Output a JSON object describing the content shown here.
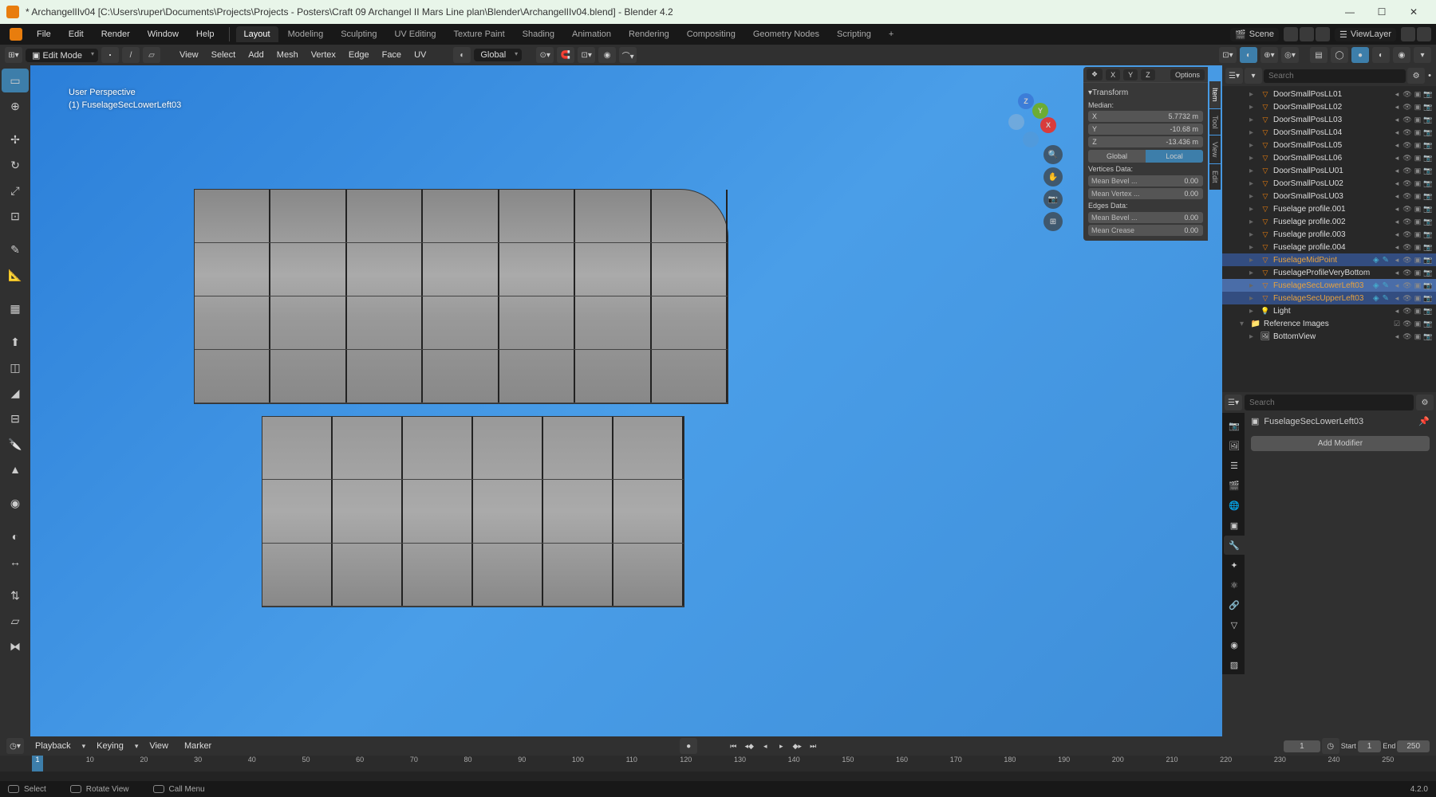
{
  "titlebar": {
    "title": "* ArchangelIIv04 [C:\\Users\\ruper\\Documents\\Projects\\Projects - Posters\\Craft 09 Archangel II Mars Line plan\\Blender\\ArchangelIIv04.blend] - Blender 4.2"
  },
  "menubar": {
    "items": [
      "File",
      "Edit",
      "Render",
      "Window",
      "Help"
    ],
    "tabs": [
      "Layout",
      "Modeling",
      "Sculpting",
      "UV Editing",
      "Texture Paint",
      "Shading",
      "Animation",
      "Rendering",
      "Compositing",
      "Geometry Nodes",
      "Scripting"
    ],
    "activeTab": "Layout",
    "scene": "Scene",
    "viewlayer": "ViewLayer"
  },
  "headerbar": {
    "mode": "Edit Mode",
    "menus": [
      "View",
      "Select",
      "Add",
      "Mesh",
      "Vertex",
      "Edge",
      "Face",
      "UV"
    ],
    "orientation": "Global"
  },
  "viewport": {
    "perspective": "User Perspective",
    "objname": "(1) FuselageSecLowerLeft03"
  },
  "npanel": {
    "xyzopts": [
      "X",
      "Y",
      "Z"
    ],
    "optionsLabel": "Options",
    "transform": "Transform",
    "median": "Median:",
    "x": {
      "axis": "X",
      "val": "5.7732 m"
    },
    "y": {
      "axis": "Y",
      "val": "-10.68 m"
    },
    "z": {
      "axis": "Z",
      "val": "-13.436 m"
    },
    "global": "Global",
    "local": "Local",
    "verticesData": "Vertices Data:",
    "meanBevel": "Mean Bevel ...",
    "meanVertex": "Mean Vertex ...",
    "edgesData": "Edges Data:",
    "meanCrease": "Mean Crease",
    "zeroA": "0.00",
    "zeroB": "0.00",
    "zeroC": "0.00",
    "zeroD": "0.00",
    "tabs": [
      "Item",
      "Tool",
      "View",
      "Edit"
    ]
  },
  "outliner": {
    "searchPlaceholder": "Search",
    "items": [
      {
        "name": "DoorSmallPosLL01",
        "indent": 1,
        "type": "mesh"
      },
      {
        "name": "DoorSmallPosLL02",
        "indent": 1,
        "type": "mesh"
      },
      {
        "name": "DoorSmallPosLL03",
        "indent": 1,
        "type": "mesh"
      },
      {
        "name": "DoorSmallPosLL04",
        "indent": 1,
        "type": "mesh"
      },
      {
        "name": "DoorSmallPosLL05",
        "indent": 1,
        "type": "mesh"
      },
      {
        "name": "DoorSmallPosLL06",
        "indent": 1,
        "type": "mesh"
      },
      {
        "name": "DoorSmallPosLU01",
        "indent": 1,
        "type": "mesh"
      },
      {
        "name": "DoorSmallPosLU02",
        "indent": 1,
        "type": "mesh"
      },
      {
        "name": "DoorSmallPosLU03",
        "indent": 1,
        "type": "mesh"
      },
      {
        "name": "Fuselage profile.001",
        "indent": 1,
        "type": "mesh"
      },
      {
        "name": "Fuselage profile.002",
        "indent": 1,
        "type": "mesh"
      },
      {
        "name": "Fuselage profile.003",
        "indent": 1,
        "type": "mesh"
      },
      {
        "name": "Fuselage profile.004",
        "indent": 1,
        "type": "mesh"
      },
      {
        "name": "FuselageMidPoint",
        "indent": 1,
        "type": "mesh",
        "sel": true,
        "orange": true,
        "badges": true
      },
      {
        "name": "FuselageProfileVeryBottom",
        "indent": 1,
        "type": "mesh"
      },
      {
        "name": "FuselageSecLowerLeft03",
        "indent": 1,
        "type": "mesh",
        "active": true,
        "orange": true,
        "badges": true
      },
      {
        "name": "FuselageSecUpperLeft03",
        "indent": 1,
        "type": "mesh",
        "sel": true,
        "orange": true,
        "badges": true
      },
      {
        "name": "Light",
        "indent": 1,
        "type": "light"
      }
    ],
    "collection": "Reference Images",
    "collItem": "BottomView"
  },
  "properties": {
    "searchPlaceholder": "Search",
    "obj": "FuselageSecLowerLeft03",
    "addmod": "Add Modifier"
  },
  "timeline": {
    "menus": [
      "Playback",
      "Keying",
      "View",
      "Marker"
    ],
    "frame": "1",
    "start": "Start",
    "startval": "1",
    "end": "End",
    "endval": "250",
    "ticks": [
      "0",
      "10",
      "20",
      "30",
      "40",
      "50",
      "60",
      "70",
      "80",
      "90",
      "100",
      "110",
      "120",
      "130",
      "140",
      "150",
      "160",
      "170",
      "180",
      "190",
      "200",
      "210",
      "220",
      "230",
      "240",
      "250"
    ]
  },
  "statusbar": {
    "select": "Select",
    "rotate": "Rotate View",
    "callmenu": "Call Menu",
    "version": "4.2.0"
  }
}
